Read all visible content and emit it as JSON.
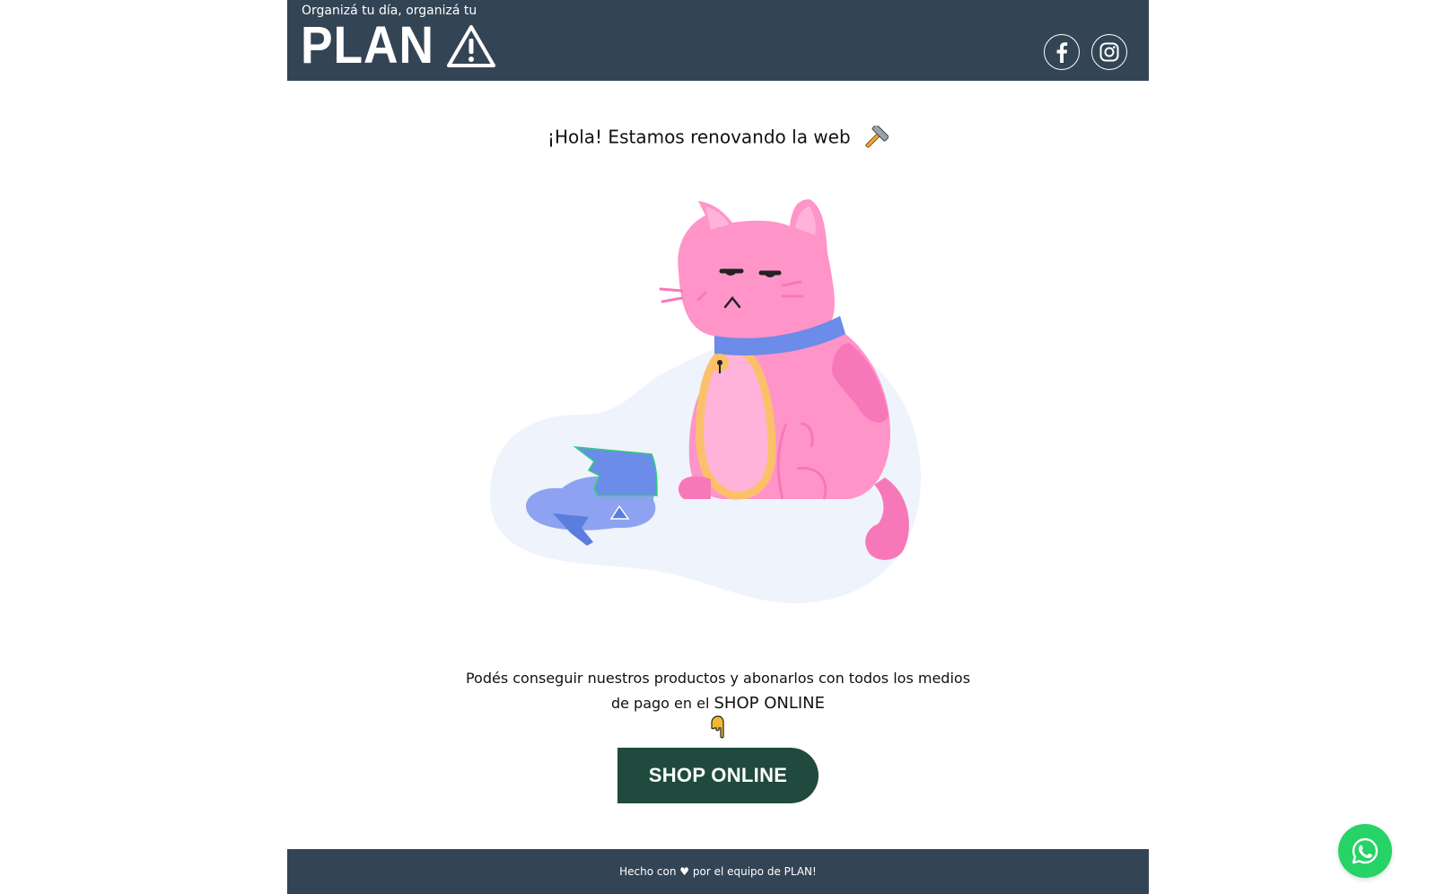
{
  "header": {
    "tagline": "Organizá tu día, organizá tu",
    "logo_text": "PLAN",
    "logo_icon": "warning-triangle-icon",
    "social": [
      {
        "name": "facebook",
        "icon": "facebook-icon"
      },
      {
        "name": "instagram",
        "icon": "instagram-icon"
      }
    ]
  },
  "main": {
    "headline": "¡Hola! Estamos renovando la web",
    "headline_icon": "hammer-icon",
    "illustration": "sad-cat-broken-vase-illustration",
    "info_text": "Podés conseguir nuestros productos y abonarlos con todos los medios de pago en el",
    "info_strong": "SHOP ONLINE",
    "pointer_icon": "pointing-down-hand-icon",
    "shop_button_label": "SHOP ONLINE"
  },
  "footer": {
    "prefix": "Hecho con",
    "heart": "♥",
    "suffix": "por el equipo de PLAN!"
  },
  "floating": {
    "whatsapp_icon": "whatsapp-icon"
  },
  "colors": {
    "header_bg": "#334455",
    "button_bg": "#1f4a3d",
    "whatsapp": "#25d366",
    "cat_pink": "#ff94c8"
  }
}
